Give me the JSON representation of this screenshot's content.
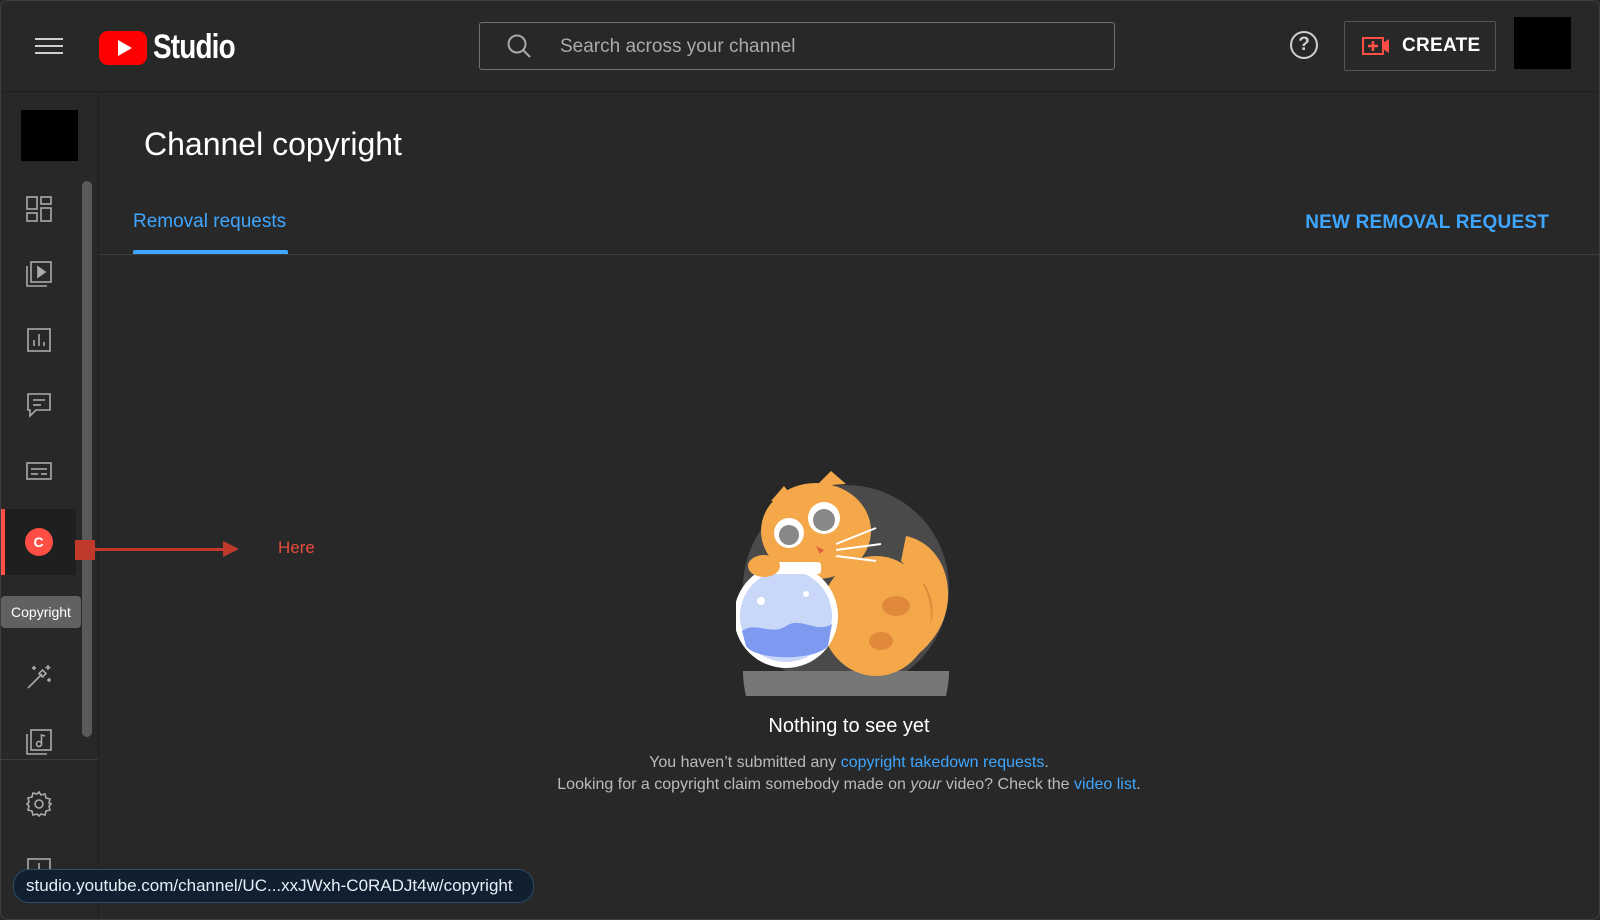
{
  "header": {
    "logo_text": "Studio",
    "search_placeholder": "Search across your channel",
    "help_symbol": "?",
    "create_label": "CREATE"
  },
  "sidebar": {
    "items": [
      {
        "name": "dashboard",
        "icon": "dashboard-icon"
      },
      {
        "name": "content",
        "icon": "video-library-icon"
      },
      {
        "name": "analytics",
        "icon": "analytics-icon"
      },
      {
        "name": "comments",
        "icon": "comments-icon"
      },
      {
        "name": "subtitles",
        "icon": "subtitles-icon"
      },
      {
        "name": "copyright",
        "icon": "copyright-icon",
        "active": true,
        "badge": "C"
      },
      {
        "name": "customization",
        "icon": "magic-wand-icon"
      },
      {
        "name": "audio-library",
        "icon": "audio-library-icon"
      },
      {
        "name": "settings",
        "icon": "gear-icon"
      },
      {
        "name": "feedback",
        "icon": "feedback-icon"
      }
    ],
    "tooltip": "Copyright"
  },
  "annotation": {
    "label": "Here",
    "color": "#c0392b"
  },
  "main": {
    "title": "Channel copyright",
    "tab": "Removal requests",
    "new_request": "NEW REMOVAL REQUEST",
    "empty": {
      "title": "Nothing to see yet",
      "line1_prefix": "You haven’t submitted any ",
      "line1_link": "copyright takedown requests",
      "line1_suffix": ".",
      "line2_prefix": "Looking for a copyright claim somebody made on ",
      "line2_italic": "your",
      "line2_middle": " video? Check the ",
      "line2_link": "video list",
      "line2_suffix": "."
    }
  },
  "status_bar": {
    "url": "studio.youtube.com/channel/UC...xxJWxh-C0RADJt4w/copyright"
  },
  "colors": {
    "background": "#282828",
    "accent_blue": "#3ea6ff",
    "active_red": "#ff4e45",
    "brand_red": "#ff0000"
  }
}
